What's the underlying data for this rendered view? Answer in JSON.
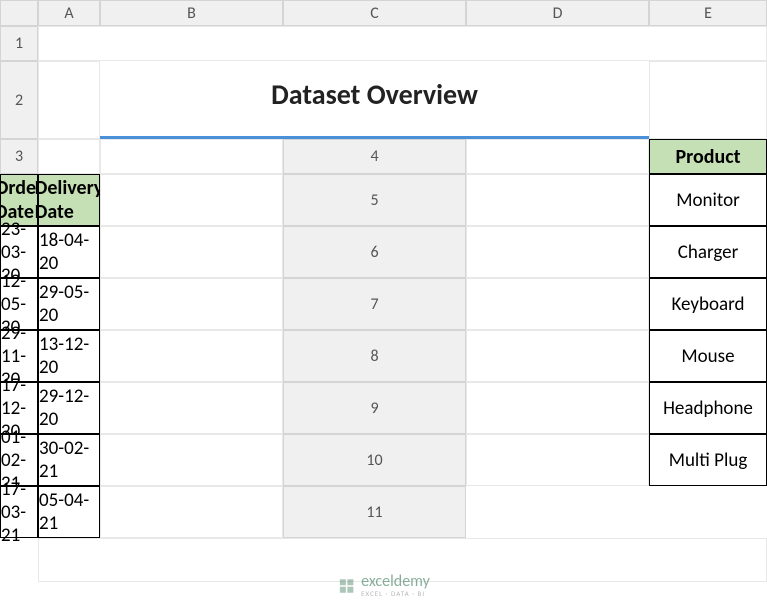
{
  "columns": [
    "A",
    "B",
    "C",
    "D",
    "E"
  ],
  "rows": [
    "1",
    "2",
    "3",
    "4",
    "5",
    "6",
    "7",
    "8",
    "9",
    "10",
    "11"
  ],
  "title": "Dataset Overview",
  "headers": {
    "product": "Product",
    "order_date": "Order Date",
    "delivery_date": "Delivery Date"
  },
  "data": [
    {
      "product": "Monitor",
      "order_date": "23-03-20",
      "delivery_date": "18-04-20"
    },
    {
      "product": "Charger",
      "order_date": "12-05-20",
      "delivery_date": "29-05-20"
    },
    {
      "product": "Keyboard",
      "order_date": "29-11-20",
      "delivery_date": "13-12-20"
    },
    {
      "product": "Mouse",
      "order_date": "17-12-20",
      "delivery_date": "29-12-20"
    },
    {
      "product": "Headphone",
      "order_date": "01-02-21",
      "delivery_date": "30-02-21"
    },
    {
      "product": "Multi Plug",
      "order_date": "17-03-21",
      "delivery_date": "05-04-21"
    }
  ],
  "watermark": {
    "main": "exceldemy",
    "sub": "EXCEL · DATA · BI"
  },
  "chart_data": {
    "type": "table",
    "title": "Dataset Overview",
    "columns": [
      "Product",
      "Order Date",
      "Delivery Date"
    ],
    "rows": [
      [
        "Monitor",
        "23-03-20",
        "18-04-20"
      ],
      [
        "Charger",
        "12-05-20",
        "29-05-20"
      ],
      [
        "Keyboard",
        "29-11-20",
        "13-12-20"
      ],
      [
        "Mouse",
        "17-12-20",
        "29-12-20"
      ],
      [
        "Headphone",
        "01-02-21",
        "30-02-21"
      ],
      [
        "Multi Plug",
        "17-03-21",
        "05-04-21"
      ]
    ]
  }
}
